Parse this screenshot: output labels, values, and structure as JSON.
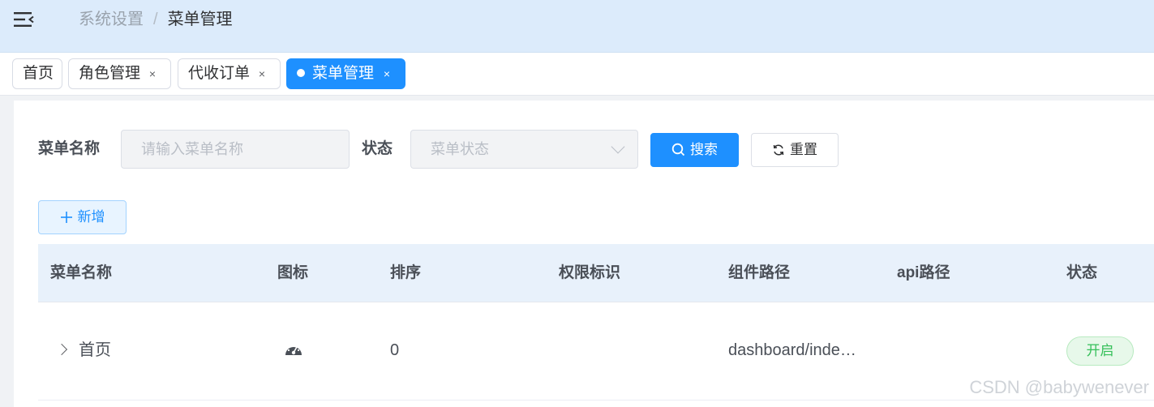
{
  "header": {
    "breadcrumb": [
      "系统设置",
      "菜单管理"
    ],
    "separator": "/"
  },
  "tags": [
    {
      "label": "首页",
      "closable": false,
      "active": false
    },
    {
      "label": "角色管理",
      "closable": true,
      "active": false
    },
    {
      "label": "代收订单",
      "closable": true,
      "active": false
    },
    {
      "label": "菜单管理",
      "closable": true,
      "active": true
    }
  ],
  "close_glyph": "×",
  "search": {
    "name_label": "菜单名称",
    "name_placeholder": "请输入菜单名称",
    "status_label": "状态",
    "status_placeholder": "菜单状态",
    "search_button": "搜索",
    "reset_button": "重置"
  },
  "toolbar": {
    "add_button": "新增"
  },
  "table": {
    "columns": [
      "菜单名称",
      "图标",
      "排序",
      "权限标识",
      "组件路径",
      "api路径",
      "状态"
    ],
    "rows": [
      {
        "name": "首页",
        "icon": "dashboard-icon",
        "order": "0",
        "permission": "",
        "component": "dashboard/inde…",
        "api": "",
        "status": "开启"
      }
    ]
  },
  "watermark": "CSDN @babywenever",
  "colors": {
    "primary": "#1e90ff",
    "topbar": "#dcebfb",
    "success": "#36c05a"
  }
}
